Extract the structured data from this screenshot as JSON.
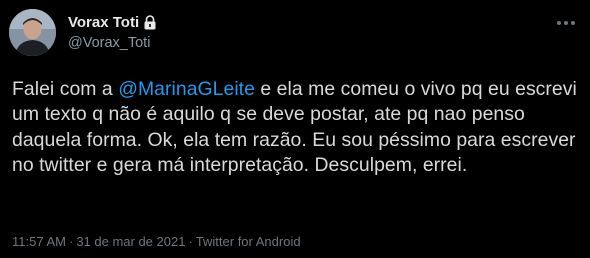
{
  "author": {
    "display_name": "Vorax Toti",
    "handle": "@Vorax_Toti",
    "protected_icon": "lock-icon",
    "avatar_icon": "profile-photo"
  },
  "tweet": {
    "text_before_mention": "Falei com a ",
    "mention": "@MarinaGLeite",
    "text_after_mention": " e ela me comeu o vivo pq eu escrevi um texto q não é aquilo q se deve postar, ate pq nao penso daquela forma. Ok, ela tem razão. Eu sou péssimo para escrever no twitter e gera má interpretação. Desculpem, errei."
  },
  "meta": {
    "time": "11:57 AM",
    "separator": "·",
    "date": "31 de mar de 2021",
    "source": "Twitter for Android"
  },
  "colors": {
    "background": "#000000",
    "text": "#d9d9d9",
    "mention": "#1d9bf0",
    "secondary": "#8b98a5",
    "meta": "#6e767d"
  },
  "more_icon": "ellipsis-icon"
}
